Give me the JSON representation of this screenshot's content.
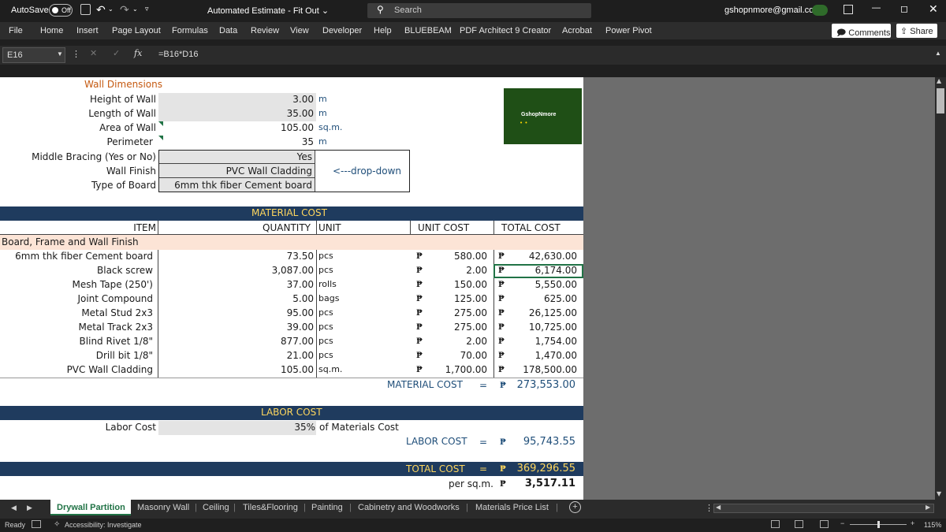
{
  "title_bar": {
    "autosave_label": "AutoSave",
    "autosave_state": "Off",
    "doc_title": "Automated Estimate - Fit Out",
    "search_placeholder": "Search",
    "account_email": "gshopnmore@gmail.com"
  },
  "ribbon": {
    "tabs": [
      "File",
      "Home",
      "Insert",
      "Page Layout",
      "Formulas",
      "Data",
      "Review",
      "View",
      "Developer",
      "Help",
      "BLUEBEAM",
      "PDF Architect 9 Creator",
      "Acrobat",
      "Power Pivot"
    ],
    "comments_label": "Comments",
    "share_label": "Share"
  },
  "formula_bar": {
    "name_box": "E16",
    "formula": "=B16*D16",
    "fx_label": "fx"
  },
  "wall": {
    "heading": "Wall Dimensions",
    "rows": [
      {
        "label": "Height of Wall",
        "value": "3.00",
        "unit": "m"
      },
      {
        "label": "Length of Wall",
        "value": "35.00",
        "unit": "m"
      },
      {
        "label": "Area of Wall",
        "value": "105.00",
        "unit": "sq.m."
      },
      {
        "label": "Perimeter",
        "value": "35",
        "unit": "m"
      }
    ],
    "options": [
      {
        "label": "Middle Bracing (Yes or No)",
        "value": "Yes"
      },
      {
        "label": "Wall Finish",
        "value": "PVC Wall Cladding"
      },
      {
        "label": "Type of Board",
        "value": "6mm thk fiber Cement board"
      }
    ],
    "dropdown_note": "<---drop-down"
  },
  "logo": {
    "text": "GshopNmore"
  },
  "material": {
    "title": "MATERIAL COST",
    "headers": {
      "item": "ITEM",
      "quantity": "QUANTITY",
      "unit": "UNIT",
      "unit_cost": "UNIT COST",
      "total_cost": "TOTAL COST"
    },
    "group": "Board, Frame and Wall Finish",
    "currency": "₱",
    "items": [
      {
        "item": "6mm thk fiber Cement board",
        "qty": "73.50",
        "unit": "pcs",
        "unit_cost": "580.00",
        "total": "42,630.00"
      },
      {
        "item": "Black screw",
        "qty": "3,087.00",
        "unit": "pcs",
        "unit_cost": "2.00",
        "total": "6,174.00"
      },
      {
        "item": "Mesh Tape (250')",
        "qty": "37.00",
        "unit": "rolls",
        "unit_cost": "150.00",
        "total": "5,550.00"
      },
      {
        "item": "Joint Compound",
        "qty": "5.00",
        "unit": "bags",
        "unit_cost": "125.00",
        "total": "625.00"
      },
      {
        "item": "Metal Stud 2x3",
        "qty": "95.00",
        "unit": "pcs",
        "unit_cost": "275.00",
        "total": "26,125.00"
      },
      {
        "item": "Metal Track 2x3",
        "qty": "39.00",
        "unit": "pcs",
        "unit_cost": "275.00",
        "total": "10,725.00"
      },
      {
        "item": "Blind Rivet 1/8\"",
        "qty": "877.00",
        "unit": "pcs",
        "unit_cost": "2.00",
        "total": "1,754.00"
      },
      {
        "item": "Drill bit 1/8\"",
        "qty": "21.00",
        "unit": "pcs",
        "unit_cost": "70.00",
        "total": "1,470.00"
      },
      {
        "item": "PVC Wall Cladding",
        "qty": "105.00",
        "unit": "sq.m.",
        "unit_cost": "1,700.00",
        "total": "178,500.00"
      }
    ],
    "subtotal_label": "MATERIAL COST",
    "equals": "=",
    "subtotal_value": "273,553.00"
  },
  "labor": {
    "title": "LABOR COST",
    "label": "Labor Cost",
    "percent": "35%",
    "percent_note": "of Materials Cost",
    "cost_label": "LABOR COST",
    "equals": "=",
    "cost_value": "95,743.55"
  },
  "total": {
    "label": "TOTAL COST",
    "equals": "=",
    "value": "369,296.55",
    "per_label": "per sq.m.",
    "per_value": "3,517.11"
  },
  "sheet_tabs": [
    "Drywall Partition",
    "Masonry Wall",
    "Ceiling",
    "Tiles&Flooring",
    "Painting",
    "Cabinetry and Woodworks",
    "Materials Price List"
  ],
  "status": {
    "ready": "Ready",
    "accessibility": "Accessibility: Investigate",
    "zoom": "115%"
  }
}
